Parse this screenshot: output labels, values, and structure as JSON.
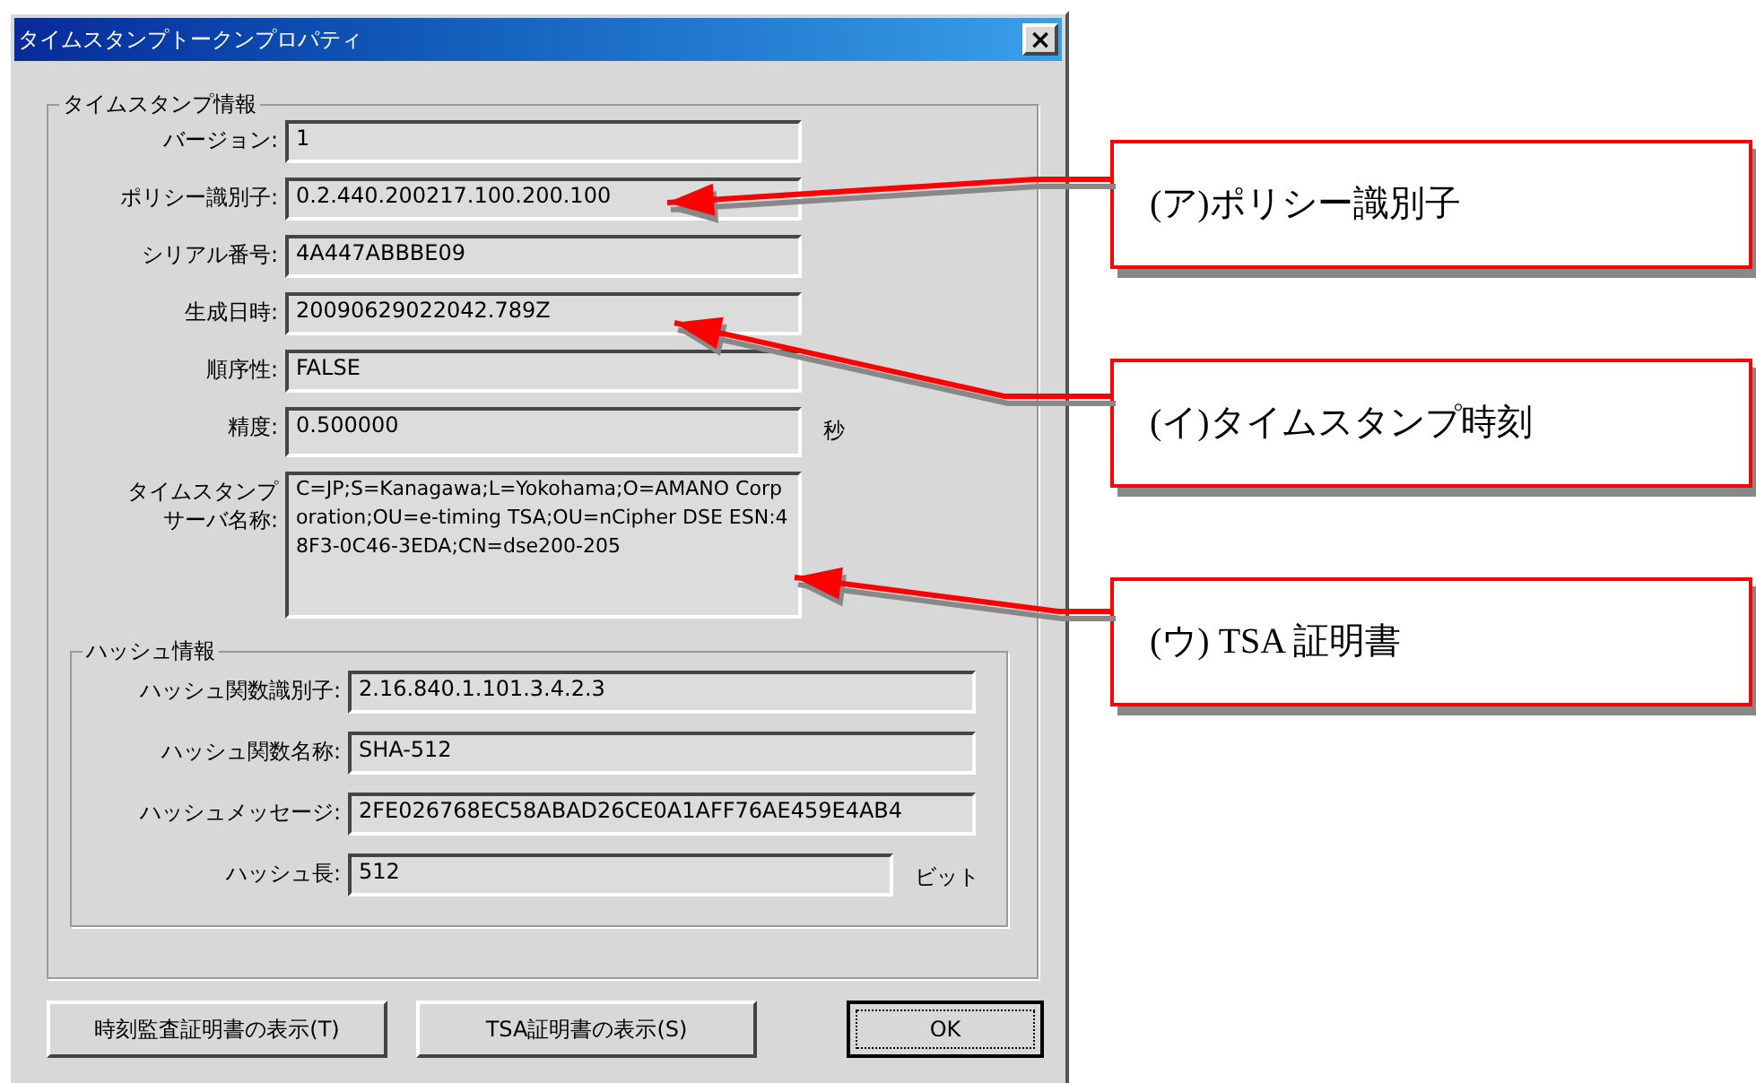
{
  "window": {
    "title": "タイムスタンプトークンプロパティ",
    "close": "×"
  },
  "timestamp_group": {
    "title": "タイムスタンプ情報",
    "fields": [
      {
        "label": "バージョン:",
        "value": "1",
        "kind": "line"
      },
      {
        "label": "ポリシー識別子:",
        "value": "0.2.440.200217.100.200.100",
        "kind": "line"
      },
      {
        "label": "シリアル番号:",
        "value": "4A447ABBBE09",
        "kind": "line"
      },
      {
        "label": "生成日時:",
        "value": "20090629022042.789Z",
        "kind": "line"
      },
      {
        "label": "順序性:",
        "value": "FALSE",
        "kind": "line"
      },
      {
        "label": "精度:",
        "value": "0.500000",
        "unit": "秒",
        "kind": "tall"
      },
      {
        "label": [
          "タイムスタンプ",
          "サーバ名称:"
        ],
        "value": "C=JP;S=Kanagawa;L=Yokohama;O=AMANO Corporation;OU=e-timing TSA;OU=nCipher DSE ESN:48F3-0C46-3EDA;CN=dse200-205",
        "kind": "multiline"
      }
    ]
  },
  "hash_group": {
    "title": "ハッシュ情報",
    "fields": [
      {
        "label": "ハッシュ関数識別子:",
        "value": "2.16.840.1.101.3.4.2.3"
      },
      {
        "label": "ハッシュ関数名称:",
        "value": "SHA-512"
      },
      {
        "label": "ハッシュメッセージ:",
        "value": "2FE026768EC58ABAD26CE0A1AFF76AE459E4AB4"
      },
      {
        "label": "ハッシュ長:",
        "value": "512",
        "unit": "ビット"
      }
    ]
  },
  "buttons": [
    {
      "label": "時刻監査証明書の表示(T)",
      "default": false
    },
    {
      "label": "TSA証明書の表示(S)",
      "default": false
    },
    {
      "label": "OK",
      "default": true
    }
  ],
  "callouts": [
    "(ア)ポリシー識別子",
    "(イ)タイムスタンプ時刻",
    "(ウ) TSA 証明書"
  ]
}
